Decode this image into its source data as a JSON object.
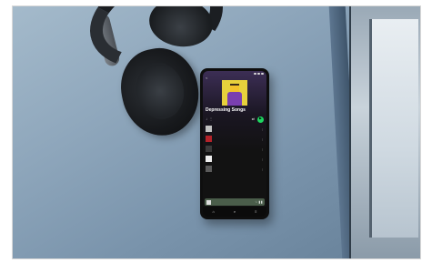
{
  "photo": {
    "subject": "smartphone-with-headphones",
    "colors": {
      "table": "#8fa7bc",
      "headphones": "#1b1e22",
      "accent_green": "#1ed760"
    }
  },
  "phone_screen": {
    "status_bar": {
      "time": ""
    },
    "back_label": "<",
    "playlist": {
      "title": "Depressing Songs",
      "owner": "",
      "meta": "",
      "cover_colors": {
        "background": "#e7d13c",
        "figure": "#7a3fb0"
      }
    },
    "controls": {
      "download_icon": "↓",
      "more_icon": "⋮",
      "shuffle_icon": "⇄",
      "play_icon": "▶"
    },
    "tracks": [
      {
        "name": "",
        "artist": "",
        "thumb_color": "#c2c2c2"
      },
      {
        "name": "",
        "artist": "",
        "thumb_color": "#b3232a"
      },
      {
        "name": "",
        "artist": "",
        "thumb_color": "#3a3a3a"
      },
      {
        "name": "",
        "artist": "",
        "thumb_color": "#eeeeee"
      },
      {
        "name": "",
        "artist": "",
        "thumb_color": "#5a5a5a"
      }
    ],
    "now_playing": {
      "title": "",
      "icons": "♡ ❚❚"
    },
    "bottom_nav": [
      {
        "icon": "⌂",
        "label": ""
      },
      {
        "icon": "⌕",
        "label": ""
      },
      {
        "icon": "≡",
        "label": ""
      }
    ]
  }
}
